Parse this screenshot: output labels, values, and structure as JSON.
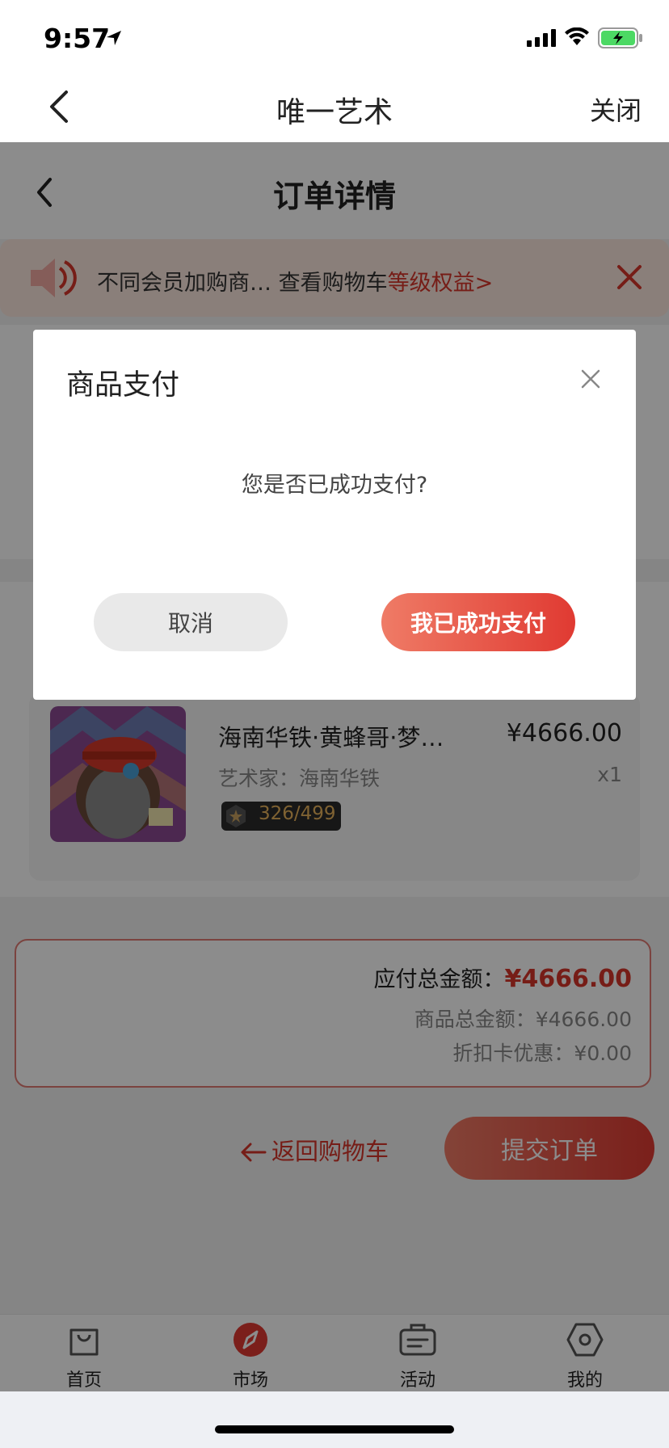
{
  "status_bar": {
    "time": "9:57"
  },
  "nav": {
    "title": "唯一艺术",
    "close_label": "关闭"
  },
  "page": {
    "title": "订单详情",
    "banner": {
      "text": "不同会员加购商…  查看购物车",
      "link": "等级权益>"
    },
    "product": {
      "name": "海南华铁·黄蜂哥·梦…",
      "price": "¥4666.00",
      "artist": "艺术家：海南华铁",
      "qty": "x1",
      "edition": "326/499"
    },
    "summary": {
      "total_label": "应付总金额：",
      "total_amount": "¥4666.00",
      "goods_total": "商品总金额：¥4666.00",
      "discount": "折扣卡优惠：¥0.00"
    },
    "back_to_cart": "返回购物车",
    "submit": "提交订单"
  },
  "modal": {
    "title": "商品支付",
    "message": "您是否已成功支付?",
    "cancel": "取消",
    "confirm": "我已成功支付"
  },
  "tabbar": {
    "items": [
      {
        "label": "首页",
        "icon": "bag-icon"
      },
      {
        "label": "市场",
        "icon": "compass-icon",
        "active": true
      },
      {
        "label": "活动",
        "icon": "ticket-icon"
      },
      {
        "label": "我的",
        "icon": "hexagon-icon"
      }
    ]
  },
  "colors": {
    "accent": "#e03a32",
    "accent_light": "#ef7b66",
    "link": "#d7362a"
  }
}
